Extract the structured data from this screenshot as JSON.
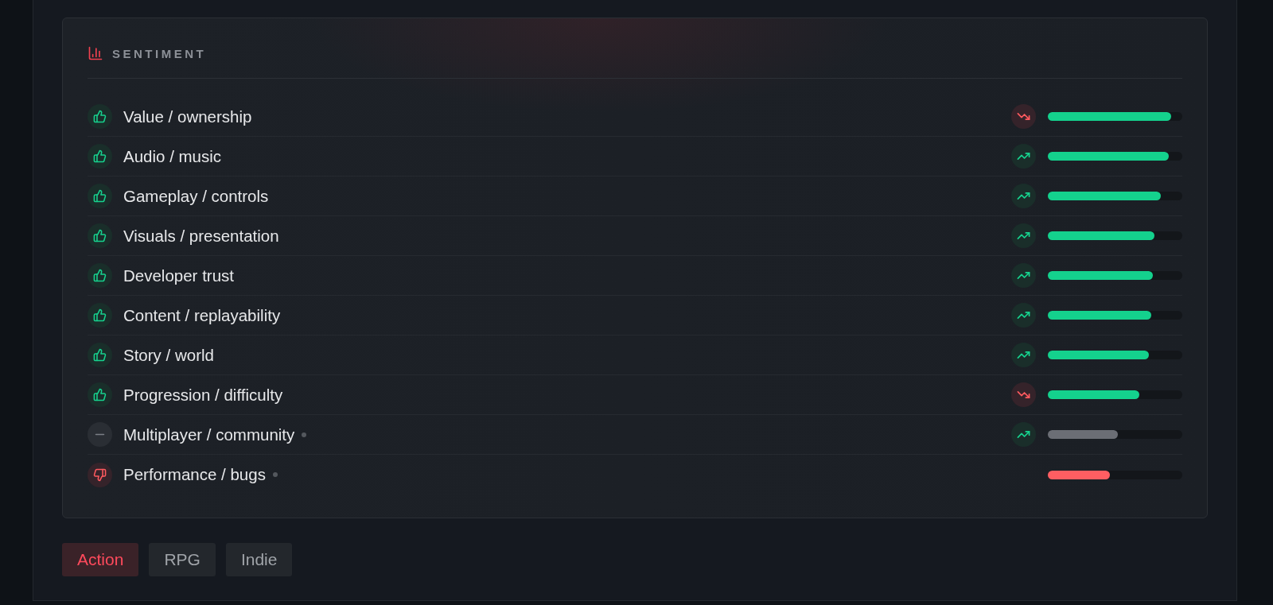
{
  "section": {
    "title": "SENTIMENT"
  },
  "rows": [
    {
      "kind": "positive",
      "label": "Value / ownership",
      "dot_marker": false,
      "trend": {
        "kind": "down"
      },
      "level": 0.92
    },
    {
      "kind": "positive",
      "label": "Audio / music",
      "dot_marker": false,
      "trend": {
        "kind": "up"
      },
      "level": 0.9
    },
    {
      "kind": "positive",
      "label": "Gameplay / controls",
      "dot_marker": false,
      "trend": {
        "kind": "up"
      },
      "level": 0.84
    },
    {
      "kind": "positive",
      "label": "Visuals / presentation",
      "dot_marker": false,
      "trend": {
        "kind": "up"
      },
      "level": 0.79
    },
    {
      "kind": "positive",
      "label": "Developer trust",
      "dot_marker": false,
      "trend": {
        "kind": "up"
      },
      "level": 0.78
    },
    {
      "kind": "positive",
      "label": "Content / replayability",
      "dot_marker": false,
      "trend": {
        "kind": "up"
      },
      "level": 0.77
    },
    {
      "kind": "positive",
      "label": "Story / world",
      "dot_marker": false,
      "trend": {
        "kind": "up"
      },
      "level": 0.75
    },
    {
      "kind": "positive",
      "label": "Progression / difficulty",
      "dot_marker": false,
      "trend": {
        "kind": "down"
      },
      "level": 0.68
    },
    {
      "kind": "neutral",
      "label": "Multiplayer / community",
      "dot_marker": true,
      "trend": {
        "kind": "up"
      },
      "level": 0.52
    },
    {
      "kind": "negative",
      "label": "Performance / bugs",
      "dot_marker": true,
      "level": 0.46
    }
  ],
  "tags": [
    {
      "label": "Action",
      "selected": true
    },
    {
      "label": "RPG",
      "selected": false
    },
    {
      "label": "Indie",
      "selected": false
    }
  ]
}
